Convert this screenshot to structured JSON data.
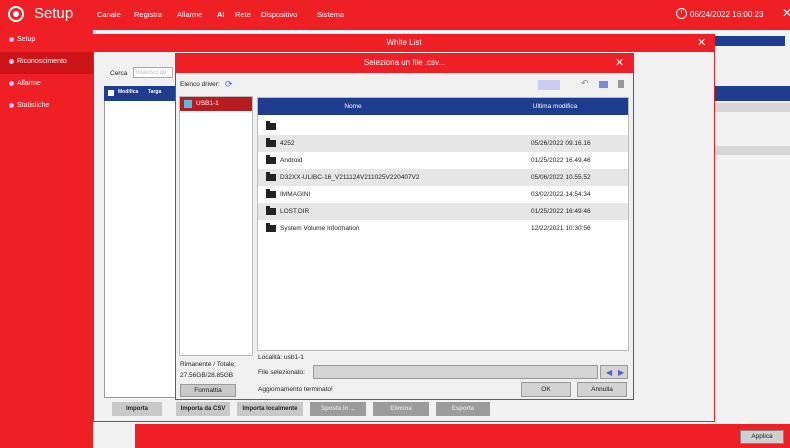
{
  "app": {
    "title": "Setup"
  },
  "nav": [
    "Canale",
    "Registra",
    "Allarme",
    "AI",
    "Rete",
    "Dispositivo",
    "Sistema"
  ],
  "datetime": "06/24/2022 16:00:23",
  "sidebar": [
    {
      "label": "Setup"
    },
    {
      "label": "Riconoscimento"
    },
    {
      "label": "Allarme"
    },
    {
      "label": "Statistiche"
    }
  ],
  "underlying": {
    "search_tab": "Cerca",
    "search_placeholder": "Inserisci qu",
    "table_headers": [
      "Modifica",
      "Targa"
    ],
    "buttons": [
      "Importa",
      "Importa da CSV",
      "Importa localmente",
      "Sposta in ...",
      "Elimina",
      "Esporta"
    ],
    "apply": "Applica"
  },
  "white_list": {
    "title": "White List"
  },
  "file_dialog": {
    "title": "Seleziona un file .csv...",
    "driver_label": "Elenco driver:",
    "driver": "USB1-1",
    "space_label": "Rimanente / Totale:",
    "space_value": "27.56GB/28.85GB",
    "format_button": "Formattia",
    "columns": [
      "Nome",
      "Ultima modifica"
    ],
    "rows": [
      {
        "name": "",
        "date": ""
      },
      {
        "name": "4252",
        "date": "05/26/2022 09.16.16"
      },
      {
        "name": "Android",
        "date": "01/25/2022 16.49.46"
      },
      {
        "name": "D32XX-ULIBC-16_V211124V211025V220407V2",
        "date": "05/06/2022 10.55.52"
      },
      {
        "name": "IMMAGINI",
        "date": "03/02/2022 14:54:34"
      },
      {
        "name": "LOST.DIR",
        "date": "01/25/2022 16:49:46"
      },
      {
        "name": "System Volume Information",
        "date": "12/22/2021 10:30:56"
      }
    ],
    "location_label": "Località: usb1-1",
    "selected_file_label": "File selezionato:",
    "status": "Aggiornamento terminato!",
    "ok": "OK",
    "cancel": "Annulla"
  },
  "icons": {
    "logo": "gear-icon",
    "refresh": "refresh-icon",
    "list_view": "list-view-icon",
    "back": "back-icon",
    "new_folder": "new-folder-icon",
    "delete": "delete-icon",
    "folder": "folder-icon"
  },
  "colors": {
    "accent": "#ee1f25",
    "header": "#1f3d8e",
    "selected": "#b81c20"
  }
}
